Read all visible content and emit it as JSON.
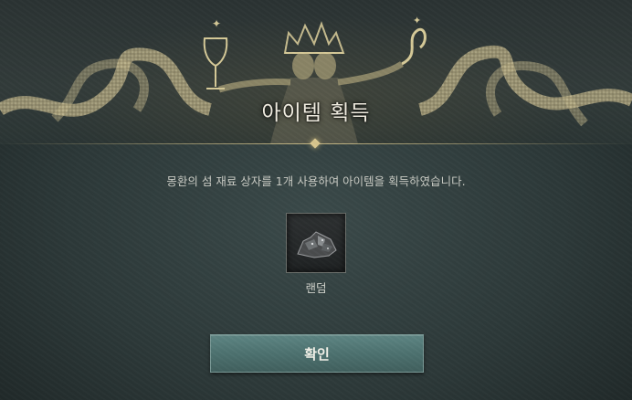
{
  "dialog": {
    "title": "아이템 획득",
    "message": "몽환의 섬 재료 상자를 1개 사용하여 아이템을 획득하였습니다.",
    "item": {
      "name": "랜덤",
      "icon": "ore-pile-icon"
    },
    "confirm_label": "확인",
    "banner_art": "crowned-two-faced-queen-with-chalice-and-serpents"
  },
  "colors": {
    "accent_gold": "#d8c68e",
    "button": "#4d7270",
    "background": "#2d3939"
  }
}
